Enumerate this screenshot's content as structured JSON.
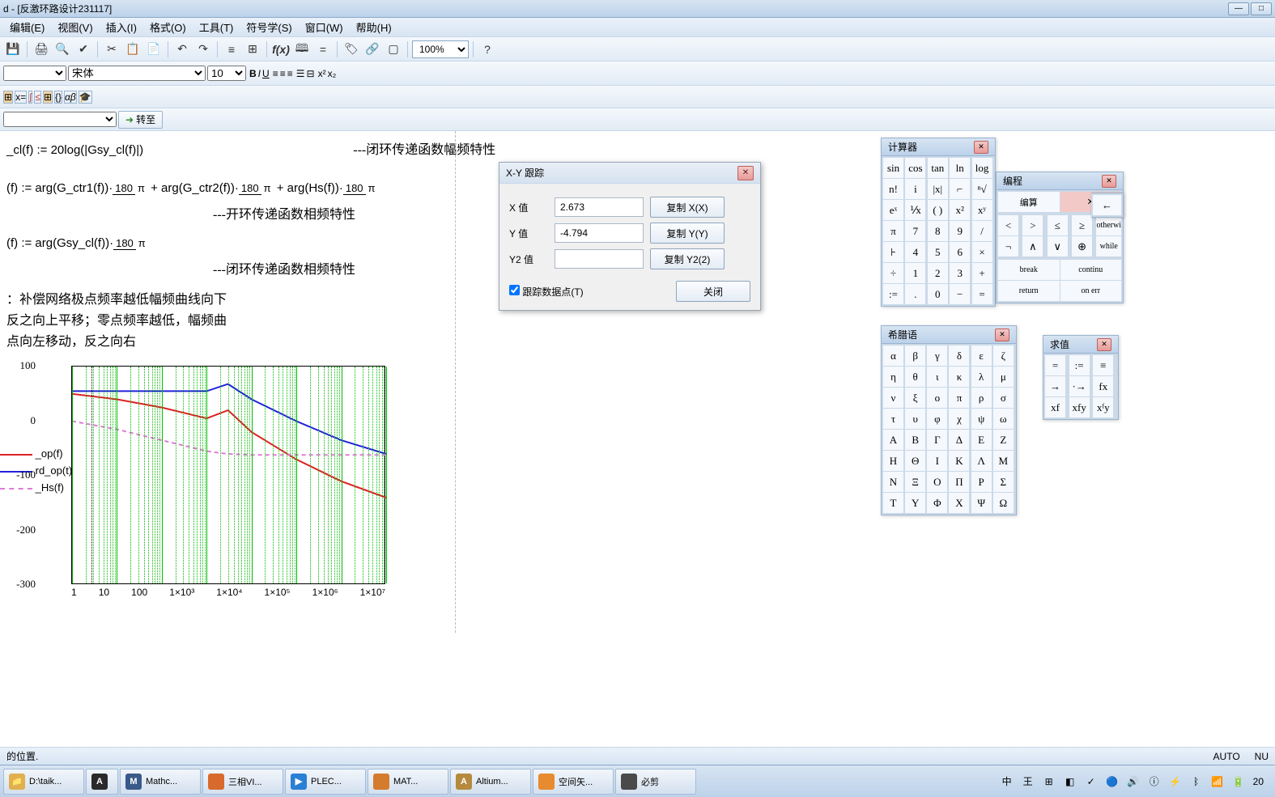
{
  "window": {
    "title": "d - [反激环路设计231117]"
  },
  "menu": [
    "编辑(E)",
    "视图(V)",
    "插入(I)",
    "格式(O)",
    "工具(T)",
    "符号学(S)",
    "窗口(W)",
    "帮助(H)"
  ],
  "toolbar": {
    "zoom": "100%",
    "font_family": "宋体",
    "font_size": "10",
    "go_label": "转至"
  },
  "math": {
    "line1": "_cl(f) := 20log(|Gsy_cl(f)|)",
    "anno1": "---闭环传递函数幅频特性",
    "line2_a": "(f) := arg(G_ctr1(f))·",
    "line2_b": " + arg(G_ctr2(f))·",
    "line2_c": " + arg(Hs(f))·",
    "anno2": "---开环传递函数相频特性",
    "line3": "(f) := arg(Gsy_cl(f))·",
    "anno3": "---闭环传递函数相频特性",
    "note1": "：补偿网络极点频率越低幅频曲线向下",
    "note2": "  反之向上平移；零点频率越低，幅频曲",
    "note3": "点向左移动，反之向右"
  },
  "dialog": {
    "title": "X-Y 跟踪",
    "x_label": "X 值",
    "y_label": "Y 值",
    "y2_label": "Y2 值",
    "x_val": "2.673",
    "y_val": "-4.794",
    "y2_val": "",
    "copy_x": "复制 X(X)",
    "copy_y": "复制 Y(Y)",
    "copy_y2": "复制 Y2(2)",
    "track": "跟踪数据点(T)",
    "close": "关闭"
  },
  "palettes": {
    "calc": {
      "title": "计算器",
      "rows": [
        [
          "sin",
          "cos",
          "tan",
          "ln",
          "log"
        ],
        [
          "n!",
          "i",
          "|x|",
          "⌐",
          "ⁿ√"
        ],
        [
          "eˣ",
          "⅟x",
          "( )",
          "x²",
          "xʸ"
        ],
        [
          "π",
          "7",
          "8",
          "9",
          "/"
        ],
        [
          "⊦",
          "4",
          "5",
          "6",
          "×"
        ],
        [
          "÷",
          "1",
          "2",
          "3",
          "+"
        ],
        [
          ":=",
          ".",
          "0",
          "−",
          "="
        ]
      ]
    },
    "greek": {
      "title": "希腊语",
      "rows": [
        [
          "α",
          "β",
          "γ",
          "δ",
          "ε",
          "ζ"
        ],
        [
          "η",
          "θ",
          "ι",
          "κ",
          "λ",
          "μ"
        ],
        [
          "ν",
          "ξ",
          "ο",
          "π",
          "ρ",
          "σ"
        ],
        [
          "τ",
          "υ",
          "φ",
          "χ",
          "ψ",
          "ω"
        ],
        [
          "Α",
          "Β",
          "Γ",
          "Δ",
          "Ε",
          "Ζ"
        ],
        [
          "Η",
          "Θ",
          "Ι",
          "Κ",
          "Λ",
          "Μ"
        ],
        [
          "Ν",
          "Ξ",
          "Ο",
          "Π",
          "Ρ",
          "Σ"
        ],
        [
          "Τ",
          "Υ",
          "Φ",
          "Χ",
          "Ψ",
          "Ω"
        ]
      ]
    },
    "prog": {
      "title": "编程",
      "rows": [
        [
          "←"
        ],
        [
          "otherwi"
        ],
        [
          "while"
        ],
        [
          "continu"
        ],
        [
          "on err"
        ]
      ],
      "left_rows": [
        [
          "编算"
        ],
        [
          "<",
          ">",
          "≤",
          "≥"
        ],
        [
          "¬",
          "∧",
          "∨",
          "⊕"
        ],
        [
          "break"
        ],
        [
          "return"
        ]
      ]
    },
    "eval": {
      "title": "求值",
      "rows": [
        [
          "=",
          ":=",
          "≡"
        ],
        [
          "→",
          "·→",
          "fx"
        ],
        [
          "xf",
          "xfy",
          "xᶠy"
        ]
      ]
    }
  },
  "chart_data": {
    "type": "line",
    "title": "",
    "xlabel": "",
    "ylabel": "",
    "x_log": true,
    "x_ticks": [
      "1",
      "10",
      "100",
      "1×10³",
      "1×10⁴",
      "1×10⁵",
      "1×10⁶",
      "1×10⁷"
    ],
    "y_ticks": [
      100,
      0,
      -100,
      -200,
      -300
    ],
    "ylim": [
      -300,
      100
    ],
    "xlim": [
      1,
      10000000.0
    ],
    "legend": [
      {
        "label": "_op(f)",
        "color": "#d22",
        "style": "solid"
      },
      {
        "label": "rd_op(t)",
        "color": "#22d",
        "style": "solid"
      },
      {
        "label": "_Hs(f)",
        "color": "#e07bd6",
        "style": "dash"
      }
    ],
    "series": [
      {
        "name": "_op(f)",
        "color": "#d22",
        "x": [
          1,
          10,
          100,
          1000,
          3000,
          10000.0,
          100000.0,
          1000000.0,
          10000000.0
        ],
        "y": [
          50,
          40,
          25,
          5,
          20,
          -20,
          -70,
          -110,
          -140
        ]
      },
      {
        "name": "rd_op(t)",
        "color": "#22d",
        "x": [
          1,
          10,
          100,
          1000,
          3000,
          10000.0,
          100000.0,
          1000000.0,
          10000000.0
        ],
        "y": [
          55,
          55,
          55,
          55,
          68,
          40,
          0,
          -35,
          -60
        ]
      },
      {
        "name": "_Hs(f)",
        "color": "#e07bd6",
        "x": [
          1,
          10,
          100,
          1000,
          3000,
          10000.0,
          100000.0,
          1000000.0,
          10000000.0
        ],
        "y": [
          0,
          -15,
          -35,
          -55,
          -60,
          -62,
          -62,
          -62,
          -62
        ]
      }
    ]
  },
  "status": {
    "left": "的位置.",
    "auto": "AUTO",
    "num": "NU"
  },
  "taskbar": {
    "items": [
      {
        "label": "D:\\taik...",
        "icon": "📁",
        "bg": "#e0b050"
      },
      {
        "label": "",
        "icon": "A",
        "bg": "#2a2a2a"
      },
      {
        "label": "Mathc...",
        "icon": "M",
        "bg": "#3a5a8a"
      },
      {
        "label": "三相VI...",
        "icon": "",
        "bg": "#d86a2e"
      },
      {
        "label": "PLEC...",
        "icon": "▶",
        "bg": "#2a7fd4"
      },
      {
        "label": "MAT...",
        "icon": "",
        "bg": "#d47b2e"
      },
      {
        "label": "Altium...",
        "icon": "A",
        "bg": "#b58a3e"
      },
      {
        "label": "空间矢...",
        "icon": "",
        "bg": "#e88a2e"
      },
      {
        "label": "必剪",
        "icon": "",
        "bg": "#4a4a4a"
      }
    ],
    "tray_time": "20"
  }
}
